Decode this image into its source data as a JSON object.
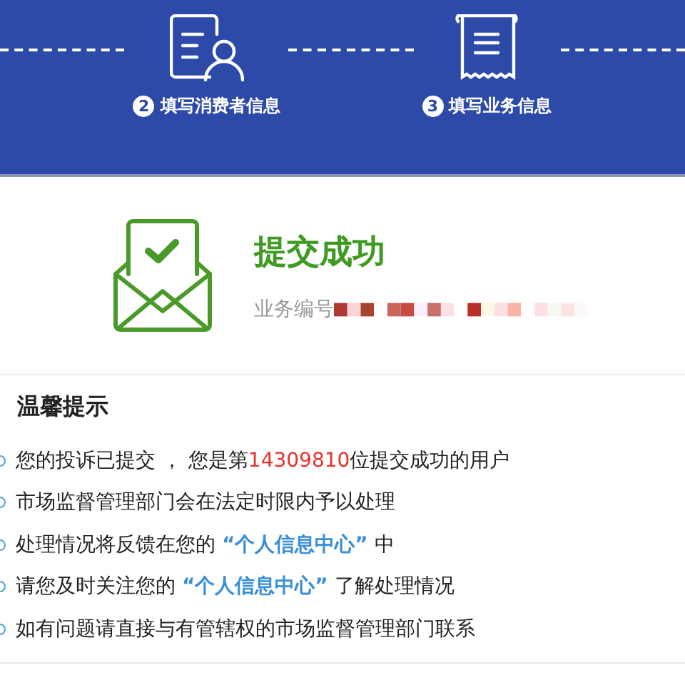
{
  "steps": [
    {
      "number": "2",
      "label": "填写消费者信息"
    },
    {
      "number": "3",
      "label": "填写业务信息"
    }
  ],
  "result": {
    "title": "提交成功",
    "number_label": "业务编号"
  },
  "tips": {
    "title": "温馨提示",
    "items": [
      [
        {
          "kind": "plain",
          "text": "您的投诉已提交 ， 您是第"
        },
        {
          "kind": "number",
          "text": "14309810"
        },
        {
          "kind": "plain",
          "text": "位提交成功的用户"
        }
      ],
      [
        {
          "kind": "plain",
          "text": "市场监督管理部门会在法定时限内予以处理"
        }
      ],
      [
        {
          "kind": "plain",
          "text": "处理情况将反馈在您的 "
        },
        {
          "kind": "link",
          "text": "“个人信息中心”"
        },
        {
          "kind": "plain",
          "text": " 中"
        }
      ],
      [
        {
          "kind": "plain",
          "text": "请您及时关注您的 "
        },
        {
          "kind": "link",
          "text": "“个人信息中心”"
        },
        {
          "kind": "plain",
          "text": " 了解处理情况"
        }
      ],
      [
        {
          "kind": "plain",
          "text": "如有问题请直接与有管辖权的市场监督管理部门联系"
        }
      ]
    ]
  }
}
